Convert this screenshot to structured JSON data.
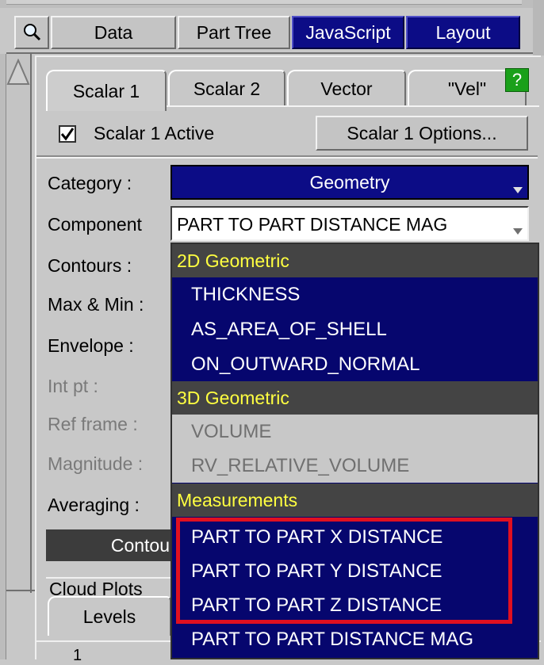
{
  "toolbar": {
    "search_icon": "magnifier-icon",
    "items": [
      {
        "label": "Data",
        "dark": false
      },
      {
        "label": "Part Tree",
        "dark": false
      },
      {
        "label": "JavaScript",
        "dark": true
      },
      {
        "label": "Layout",
        "dark": true
      }
    ]
  },
  "tabs": {
    "items": [
      "Scalar 1",
      "Scalar 2",
      "Vector",
      "\"Vel\""
    ],
    "help": "?"
  },
  "scalar": {
    "active_label": "Scalar 1 Active",
    "active_checked": true,
    "options_button": "Scalar 1 Options..."
  },
  "form": {
    "category_label": "Category :",
    "category_value": "Geometry",
    "component_label": "Component",
    "component_value": "PART TO PART DISTANCE MAG",
    "rows": [
      "Contours :",
      "Max & Min :",
      "Envelope :",
      "Int pt :",
      "Ref frame :",
      "Magnitude :",
      "Averaging :"
    ],
    "contours_bar": "Contou",
    "cloud_tab": "Cloud Plots",
    "levels_tab": "Levels",
    "bottom_row_fragment": "1"
  },
  "dropdown": {
    "groups": [
      {
        "header": "2D Geometric",
        "items": [
          "THICKNESS",
          "AS_AREA_OF_SHELL",
          "ON_OUTWARD_NORMAL"
        ],
        "disabled": false
      },
      {
        "header": "3D Geometric",
        "items": [
          "VOLUME",
          "RV_RELATIVE_VOLUME"
        ],
        "disabled": true
      },
      {
        "header": "Measurements",
        "items": [
          "PART TO PART X DISTANCE",
          "PART TO PART Y DISTANCE",
          "PART TO PART Z DISTANCE",
          "PART TO PART DISTANCE MAG"
        ],
        "disabled": false
      }
    ]
  },
  "colors": {
    "accent_blue": "#0c0c86",
    "header_yellow": "#ffff40",
    "highlight_red": "#e01020",
    "help_green": "#1aa01a"
  }
}
